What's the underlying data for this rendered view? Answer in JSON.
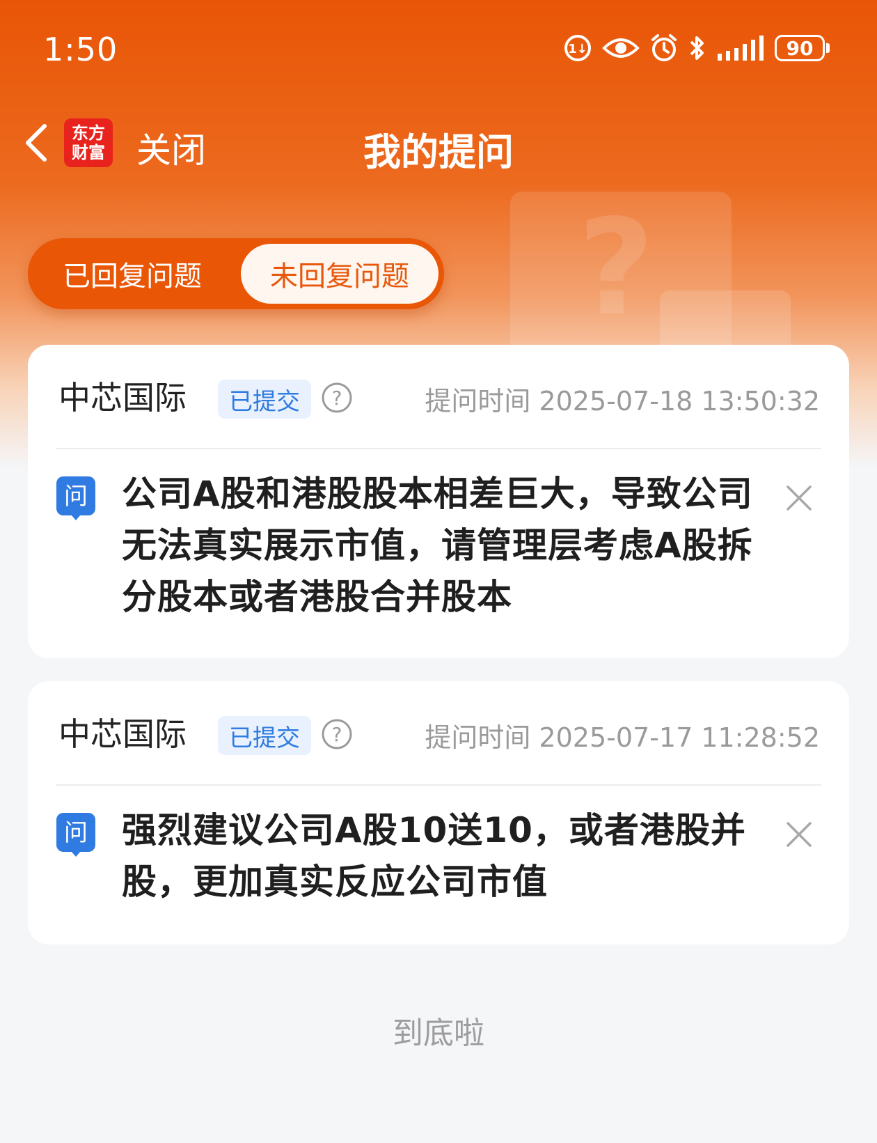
{
  "status_bar": {
    "time": "1:50",
    "battery": "90",
    "icons": [
      "data-saver-icon",
      "eye-icon",
      "alarm-icon",
      "bluetooth-icon",
      "signal-icon",
      "battery-icon"
    ]
  },
  "nav": {
    "logo_line1": "东方",
    "logo_line2": "财富",
    "close_label": "关闭",
    "title": "我的提问"
  },
  "tabs": [
    {
      "label": "已回复问题",
      "active": false
    },
    {
      "label": "未回复问题",
      "active": true
    }
  ],
  "questions": [
    {
      "company": "中芯国际",
      "status": "已提交",
      "time": "提问时间 2025-07-18 13:50:32",
      "icon_label": "问",
      "text": "公司A股和港股股本相差巨大，导致公司无法真实展示市值，请管理层考虑A股拆分股本或者港股合并股本"
    },
    {
      "company": "中芯国际",
      "status": "已提交",
      "time": "提问时间 2025-07-17 11:28:52",
      "icon_label": "问",
      "text": "强烈建议公司A股10送10，或者港股并股，更加真实反应公司市值"
    }
  ],
  "footer": {
    "end_text": "到底啦"
  },
  "colors": {
    "brand": "#e95506",
    "badge_blue": "#2f7be2",
    "active_tab_text": "#e8570c"
  }
}
